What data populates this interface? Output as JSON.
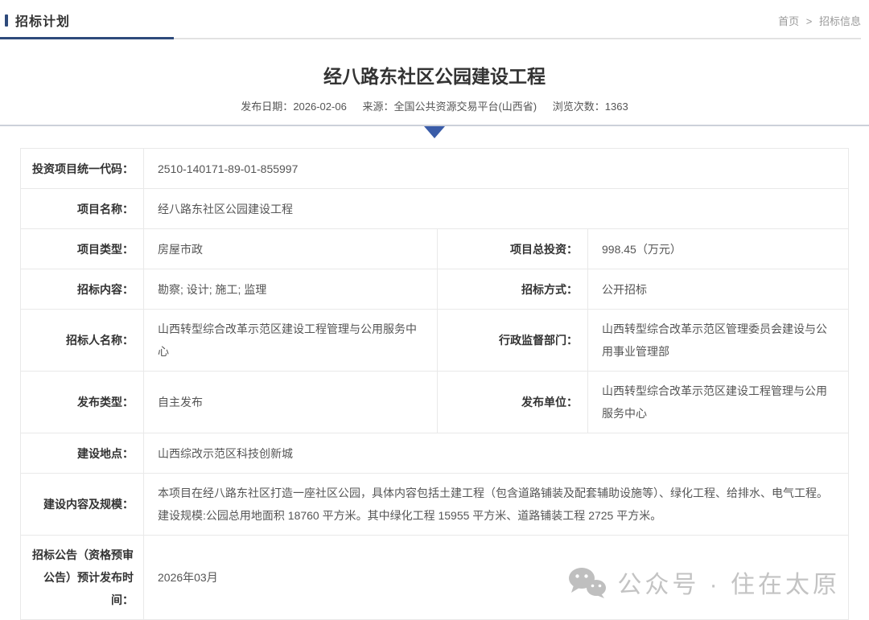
{
  "page": {
    "section_title": "招标计划",
    "breadcrumb": {
      "home": "首页",
      "separator": ">",
      "current": "招标信息"
    }
  },
  "article": {
    "title": "经八路东社区公园建设工程",
    "meta": {
      "date_label": "发布日期：",
      "date": "2026-02-06",
      "source_label": "来源：",
      "source": "全国公共资源交易平台(山西省)",
      "views_label": "浏览次数：",
      "views": "1363"
    }
  },
  "table": {
    "rows": [
      {
        "label": "投资项目统一代码：",
        "value": "2510-140171-89-01-855997"
      },
      {
        "label": "项目名称：",
        "value": "经八路东社区公园建设工程"
      },
      {
        "label": "项目类型：",
        "value": "房屋市政",
        "label2": "项目总投资：",
        "value2": "998.45（万元）"
      },
      {
        "label": "招标内容：",
        "value": "勘察; 设计; 施工; 监理",
        "label2": "招标方式：",
        "value2": "公开招标"
      },
      {
        "label": "招标人名称：",
        "value": "山西转型综合改革示范区建设工程管理与公用服务中心",
        "label2": "行政监督部门：",
        "value2": "山西转型综合改革示范区管理委员会建设与公用事业管理部"
      },
      {
        "label": "发布类型：",
        "value": "自主发布",
        "label2": "发布单位：",
        "value2": "山西转型综合改革示范区建设工程管理与公用服务中心"
      },
      {
        "label": "建设地点：",
        "value": "山西综改示范区科技创新城"
      },
      {
        "label": "建设内容及规模：",
        "value": "本项目在经八路东社区打造一座社区公园，具体内容包括土建工程（包含道路铺装及配套辅助设施等）、绿化工程、给排水、电气工程。建设规模:公园总用地面积 18760 平方米。其中绿化工程 15955 平方米、道路铺装工程 2725 平方米。"
      },
      {
        "label": "招标公告（资格预审公告）预计发布时间：",
        "value": "2026年03月"
      }
    ]
  },
  "watermark": {
    "icon": "wechat-icon",
    "text": "公众号 · 住在太原"
  },
  "colors": {
    "accent_navy": "#2e4a7b",
    "triangle_blue": "#3a5ca8",
    "divider_gray": "#ccd1da",
    "table_border": "#e9e9e9",
    "label_text": "#333333",
    "value_text": "#555555",
    "breadcrumb_gray": "#999999",
    "watermark_gray": "#c3c3c3"
  }
}
